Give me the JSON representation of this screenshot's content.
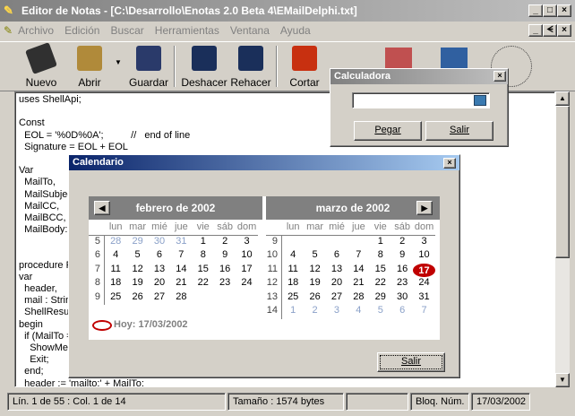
{
  "window": {
    "title": "Editor de Notas - [C:\\Desarrollo\\Enotas 2.0 Beta 4\\EMailDelphi.txt]",
    "caption_min": "_",
    "caption_max": "□",
    "caption_close": "×",
    "child_min": "_",
    "child_restore": "ᗕ",
    "child_close": "×"
  },
  "menu": [
    "Archivo",
    "Edición",
    "Buscar",
    "Herramientas",
    "Ventana",
    "Ayuda"
  ],
  "toolbar": {
    "nuevo": "Nuevo",
    "abrir": "Abrir",
    "guardar": "Guardar",
    "deshacer": "Deshacer",
    "rehacer": "Rehacer",
    "cortar": "Cortar"
  },
  "editor_lines": [
    "uses ShellApi;",
    "",
    "Const",
    "  EOL = '%0D%0A';          //   end of line",
    "  Signature = EOL + EOL",
    "",
    "Var",
    "  MailTo,",
    "  MailSubjec",
    "  MailCC,",
    "  MailBCC,",
    "  MailBody:",
    "",
    "",
    "procedure F",
    "var",
    "  header,",
    "  mail : Strin",
    "  ShellResu",
    "begin",
    "  if (MailTo =",
    "    ShowMe",
    "    Exit;",
    "  end;",
    "  header := 'mailto:' + MailTo;"
  ],
  "status": {
    "position": "Lín.  1 de 55 : Col.  1 de 14",
    "size": "Tamaño : 1574 bytes",
    "lock": "Bloq. Núm.",
    "date": "17/03/2002"
  },
  "calculadora": {
    "title": "Calculadora",
    "close": "×",
    "value": "",
    "pegar": "Pegar",
    "salir": "Salir"
  },
  "calendario": {
    "title": "Calendario",
    "close": "×",
    "prev": "◀",
    "next": "▶",
    "weekdays": [
      "lun",
      "mar",
      "mié",
      "jue",
      "vie",
      "sáb",
      "dom"
    ],
    "feb": {
      "title": "febrero de 2002",
      "weeks": [
        "5",
        "6",
        "7",
        "8",
        "9"
      ],
      "rows": [
        [
          "28",
          "29",
          "30",
          "31",
          "1",
          "2",
          "3"
        ],
        [
          "4",
          "5",
          "6",
          "7",
          "8",
          "9",
          "10"
        ],
        [
          "11",
          "12",
          "13",
          "14",
          "15",
          "16",
          "17"
        ],
        [
          "18",
          "19",
          "20",
          "21",
          "22",
          "23",
          "24"
        ],
        [
          "25",
          "26",
          "27",
          "28",
          "",
          "",
          ""
        ]
      ]
    },
    "mar": {
      "title": "marzo de 2002",
      "weeks": [
        "9",
        "10",
        "11",
        "12",
        "13",
        "14"
      ],
      "rows": [
        [
          "",
          "",
          "",
          "",
          "1",
          "2",
          "3"
        ],
        [
          "4",
          "5",
          "6",
          "7",
          "8",
          "9",
          "10"
        ],
        [
          "11",
          "12",
          "13",
          "14",
          "15",
          "16",
          "17"
        ],
        [
          "18",
          "19",
          "20",
          "21",
          "22",
          "23",
          "24"
        ],
        [
          "25",
          "26",
          "27",
          "28",
          "29",
          "30",
          "31"
        ],
        [
          "1",
          "2",
          "3",
          "4",
          "5",
          "6",
          "7"
        ]
      ]
    },
    "today_label": "Hoy: 17/03/2002",
    "salir": "Salir"
  }
}
